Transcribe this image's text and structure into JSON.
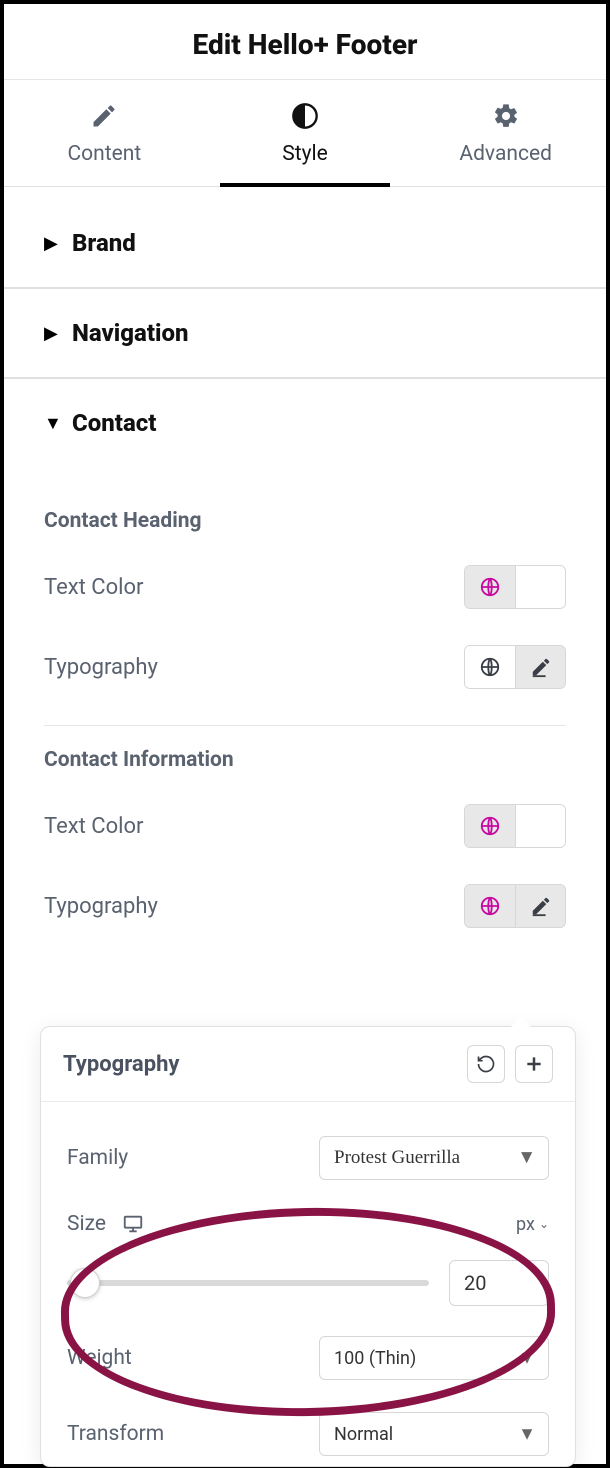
{
  "header": {
    "title": "Edit Hello+ Footer"
  },
  "tabs": {
    "content": "Content",
    "style": "Style",
    "advanced": "Advanced",
    "active": "style"
  },
  "sections": {
    "brand": {
      "title": "Brand",
      "open": false
    },
    "navigation": {
      "title": "Navigation",
      "open": false
    },
    "contact": {
      "title": "Contact",
      "open": true,
      "heading_label": "Contact Heading",
      "info_label": "Contact Information",
      "controls": {
        "text_color": "Text Color",
        "typography": "Typography"
      }
    }
  },
  "popover": {
    "title": "Typography",
    "family_label": "Family",
    "family_value": "Protest Guerrilla",
    "size_label": "Size",
    "size_unit": "px",
    "size_value": "20",
    "weight_label": "Weight",
    "weight_value": "100 (Thin)",
    "transform_label": "Transform",
    "transform_value": "Normal"
  }
}
